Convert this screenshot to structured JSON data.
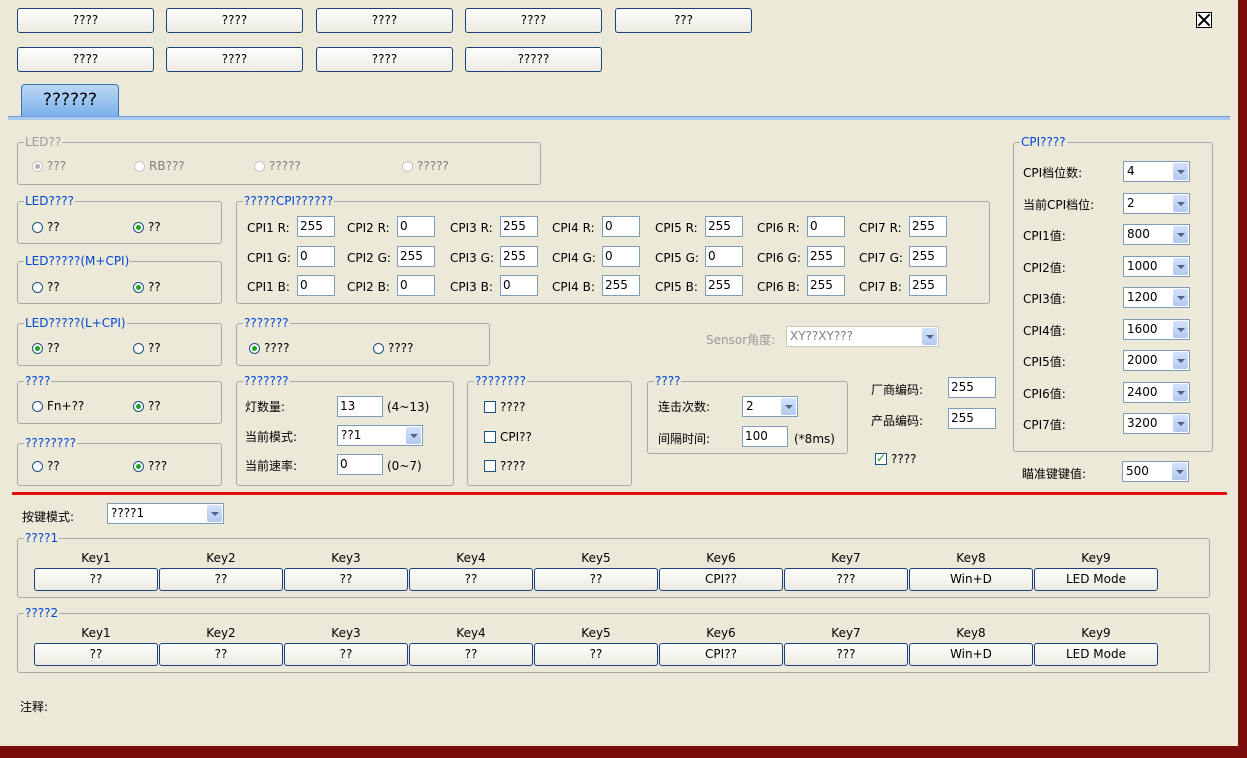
{
  "top_row1": [
    "????",
    "????",
    "????",
    "????",
    "???"
  ],
  "top_row2": [
    "????",
    "????",
    "????",
    "?????"
  ],
  "tab_label": "??????",
  "led_group": {
    "title": "LED??",
    "opt1": "???",
    "opt2": "RB???",
    "opt3": "?????",
    "opt4": "?????"
  },
  "led4": {
    "title": "LED????",
    "opt1": "??",
    "opt2": "??"
  },
  "led_mcpi": {
    "title": "LED?????(M+CPI)",
    "opt1": "??",
    "opt2": "??"
  },
  "led_lcpi": {
    "title": "LED?????(L+CPI)",
    "opt1": "??",
    "opt2": "??"
  },
  "fn_group": {
    "title": "????",
    "opt1": "Fn+??",
    "opt2": "??"
  },
  "eight_group": {
    "title": "????????",
    "opt1": "??",
    "opt2": "???"
  },
  "cpi_color": {
    "title": "?????CPI??????",
    "rows": [
      {
        "labels": [
          "CPI1 R:",
          "CPI2 R:",
          "CPI3 R:",
          "CPI4 R:",
          "CPI5 R:",
          "CPI6 R:",
          "CPI7 R:"
        ],
        "values": [
          "255",
          "0",
          "255",
          "0",
          "255",
          "0",
          "255"
        ]
      },
      {
        "labels": [
          "CPI1 G:",
          "CPI2 G:",
          "CPI3 G:",
          "CPI4 G:",
          "CPI5 G:",
          "CPI6 G:",
          "CPI7 G:"
        ],
        "values": [
          "0",
          "255",
          "255",
          "0",
          "0",
          "255",
          "255"
        ]
      },
      {
        "labels": [
          "CPI1 B:",
          "CPI2 B:",
          "CPI3 B:",
          "CPI4 B:",
          "CPI5 B:",
          "CPI6 B:",
          "CPI7 B:"
        ],
        "values": [
          "0",
          "0",
          "0",
          "255",
          "255",
          "255",
          "255"
        ]
      }
    ]
  },
  "seven_group": {
    "title": "???????",
    "opt1": "????",
    "opt2": "????"
  },
  "sensor": {
    "label": "Sensor角度:",
    "value": "XY??XY???"
  },
  "light_group": {
    "title": "???????",
    "count_label": "灯数量:",
    "count_value": "13",
    "count_range": "(4~13)",
    "mode_label": "当前模式:",
    "mode_value": "??1",
    "speed_label": "当前速率:",
    "speed_value": "0",
    "speed_range": "(0~7)"
  },
  "check_group": {
    "title": "????????",
    "c1": "????",
    "c2": "CPI??",
    "c3": "????"
  },
  "click_group": {
    "title": "????",
    "count_label": "连击次数:",
    "count_value": "2",
    "interval_label": "间隔时间:",
    "interval_value": "100",
    "interval_unit": "(*8ms)"
  },
  "vendor": {
    "label": "厂商编码:",
    "value": "255",
    "product_label": "产品编码:",
    "product_value": "255",
    "check_label": "????"
  },
  "cpi_panel": {
    "title": "CPI????",
    "rows": [
      {
        "label": "CPI档位数:",
        "value": "4"
      },
      {
        "label": "当前CPI档位:",
        "value": "2"
      },
      {
        "label": "CPI1值:",
        "value": "800"
      },
      {
        "label": "CPI2值:",
        "value": "1000"
      },
      {
        "label": "CPI3值:",
        "value": "1200"
      },
      {
        "label": "CPI4值:",
        "value": "1600"
      },
      {
        "label": "CPI5值:",
        "value": "2000"
      },
      {
        "label": "CPI6值:",
        "value": "2400"
      },
      {
        "label": "CPI7值:",
        "value": "3200"
      }
    ],
    "report_label": "瞄准键键值:",
    "report_value": "500"
  },
  "key_mode": {
    "label": "按键模式:",
    "value": "????1"
  },
  "key_groups": [
    {
      "title": "????1",
      "keys": [
        "Key1",
        "Key2",
        "Key3",
        "Key4",
        "Key5",
        "Key6",
        "Key7",
        "Key8",
        "Key9"
      ],
      "values": [
        "??",
        "??",
        "??",
        "??",
        "??",
        "CPI??",
        "???",
        "Win+D",
        "LED Mode"
      ]
    },
    {
      "title": "????2",
      "keys": [
        "Key1",
        "Key2",
        "Key3",
        "Key4",
        "Key5",
        "Key6",
        "Key7",
        "Key8",
        "Key9"
      ],
      "values": [
        "??",
        "??",
        "??",
        "??",
        "??",
        "CPI??",
        "???",
        "Win+D",
        "LED Mode"
      ]
    }
  ],
  "note_label": "注释:"
}
